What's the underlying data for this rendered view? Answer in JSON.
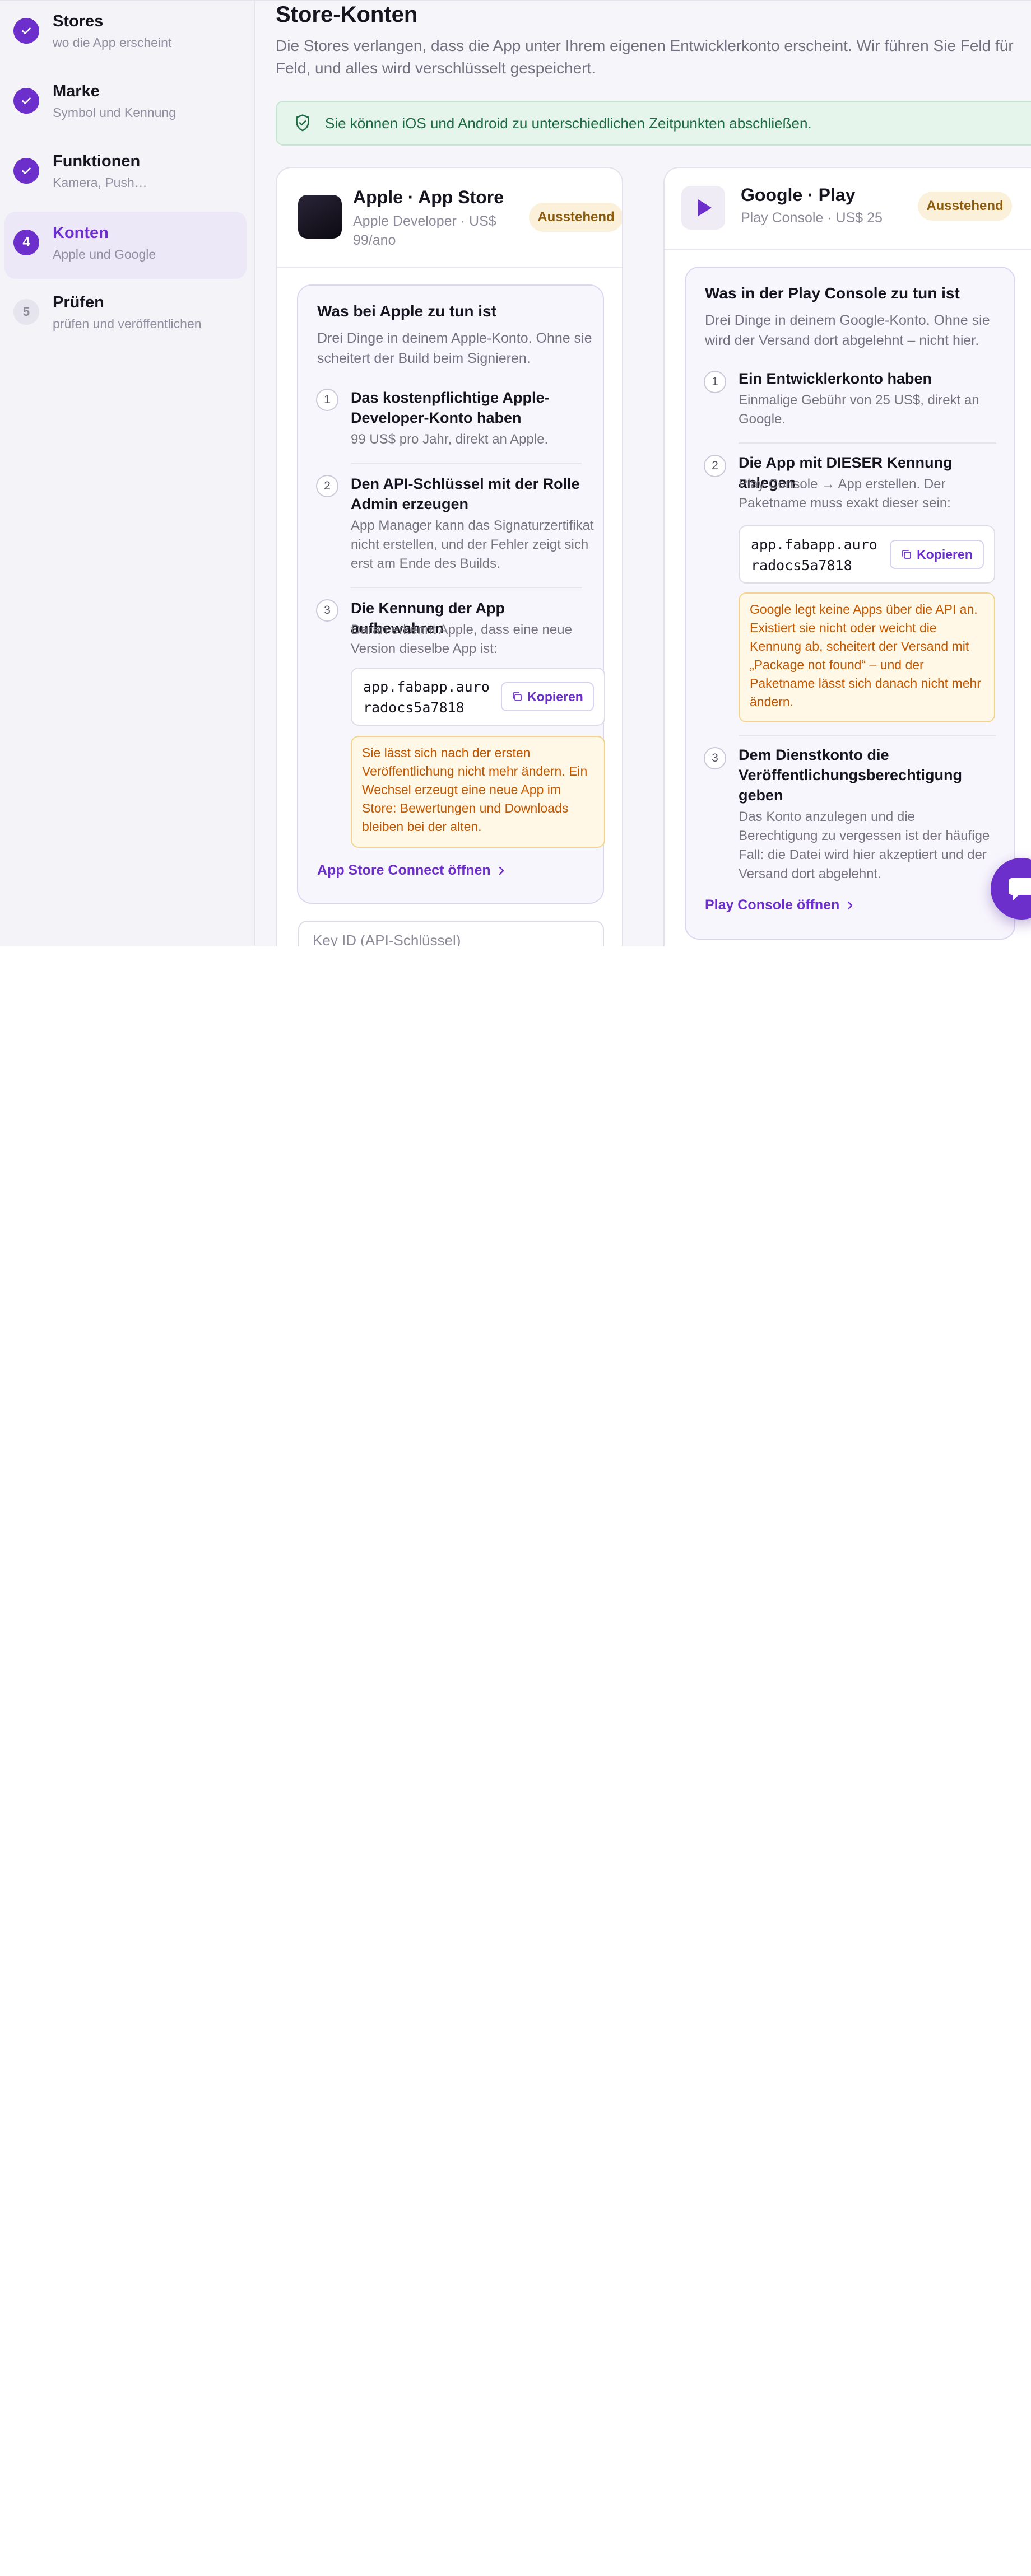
{
  "sidebar": {
    "steps": [
      {
        "number": "1",
        "title": "Stores",
        "subtitle": "wo die App erscheint",
        "state": "done"
      },
      {
        "number": "2",
        "title": "Marke",
        "subtitle": "Symbol und Kennung",
        "state": "done"
      },
      {
        "number": "3",
        "title": "Funktionen",
        "subtitle": "Kamera, Push…",
        "state": "done"
      },
      {
        "number": "4",
        "title": "Konten",
        "subtitle": "Apple und Google",
        "state": "active"
      },
      {
        "number": "5",
        "title": "Prüfen",
        "subtitle": "prüfen und veröffentlichen",
        "state": "todo"
      }
    ]
  },
  "page": {
    "title": "Store-Konten",
    "intro": "Die Stores verlangen, dass die App unter Ihrem eigenen Entwicklerkonto erscheint. Wir führen Sie Feld für Feld, und alles wird verschlüsselt gespeichert.",
    "note": "Sie können iOS und Android zu unterschiedlichen Zeitpunkten abschließen."
  },
  "apple": {
    "title": "Apple · App Store",
    "subtitle": "Apple Developer · US$ 99/ano",
    "status": "Ausstehend",
    "panel_title": "Was bei Apple zu tun ist",
    "panel_desc": "Drei Dinge in deinem Apple-Konto. Ohne sie scheitert der Build beim Signieren.",
    "steps": [
      {
        "number": "1",
        "title": "Das kostenpflichtige Apple-Developer-Konto haben",
        "desc": "99 US$ pro Jahr, direkt an Apple."
      },
      {
        "number": "2",
        "title": "Den API-Schlüssel mit der Rolle Admin erzeugen",
        "desc": "App Manager kann das Signaturzertifikat nicht erstellen, und der Fehler zeigt sich erst am Ende des Builds."
      },
      {
        "number": "3",
        "title": "Die Kennung der App aufbewahren",
        "desc": "Daran erkennt Apple, dass eine neue Version dieselbe App ist:"
      }
    ],
    "bundle_id_line1": "app.fabapp.auro",
    "bundle_id_line2": "radocs5a7818",
    "copy_label": "Kopieren",
    "warning": "Sie lässt sich nach der ersten Veröffentlichung nicht mehr ändern. Ein Wechsel erzeugt eine neue App im Store: Bewertungen und Downloads bleiben bei der alten.",
    "link": "App Store Connect öffnen",
    "key_placeholder": "Key ID (API-Schlüssel)"
  },
  "google": {
    "title": "Google · Play",
    "subtitle": "Play Console · US$ 25",
    "status": "Ausstehend",
    "panel_title": "Was in der Play Console zu tun ist",
    "panel_desc": "Drei Dinge in deinem Google-Konto. Ohne sie wird der Versand dort abgelehnt – nicht hier.",
    "steps": [
      {
        "number": "1",
        "title": "Ein Entwicklerkonto haben",
        "desc": "Einmalige Gebühr von 25 US$, direkt an Google."
      },
      {
        "number": "2",
        "title": "Die App mit DIESER Kennung anlegen",
        "desc": "Play Console → App erstellen. Der Paketname muss exakt dieser sein:"
      },
      {
        "number": "3",
        "title": "Dem Dienstkonto die Veröffentlichungsberechtigung geben",
        "desc": "Das Konto anzulegen und die Berechtigung zu vergessen ist der häufige Fall: die Datei wird hier akzeptiert und der Versand dort abgelehnt."
      }
    ],
    "package_line1": "app.fabapp.auro",
    "package_line2": "radocs5a7818",
    "copy_label": "Kopieren",
    "warning": "Google legt keine Apps über die API an. Existiert sie nicht oder weicht die Kennung ab, scheitert der Versand mit „Package not found“ – und der Paketname lässt sich danach nicht mehr ändern.",
    "link": "Play Console öffnen"
  },
  "colors": {
    "accent": "#6d2fcb",
    "success_bg": "#e6f5ec",
    "warning_bg": "#fff8e6",
    "pending_badge": "#fbf1da"
  },
  "icons": [
    "check-icon",
    "shield-check-icon",
    "play-icon",
    "copy-icon",
    "chevron-right-icon",
    "chat-icon"
  ]
}
